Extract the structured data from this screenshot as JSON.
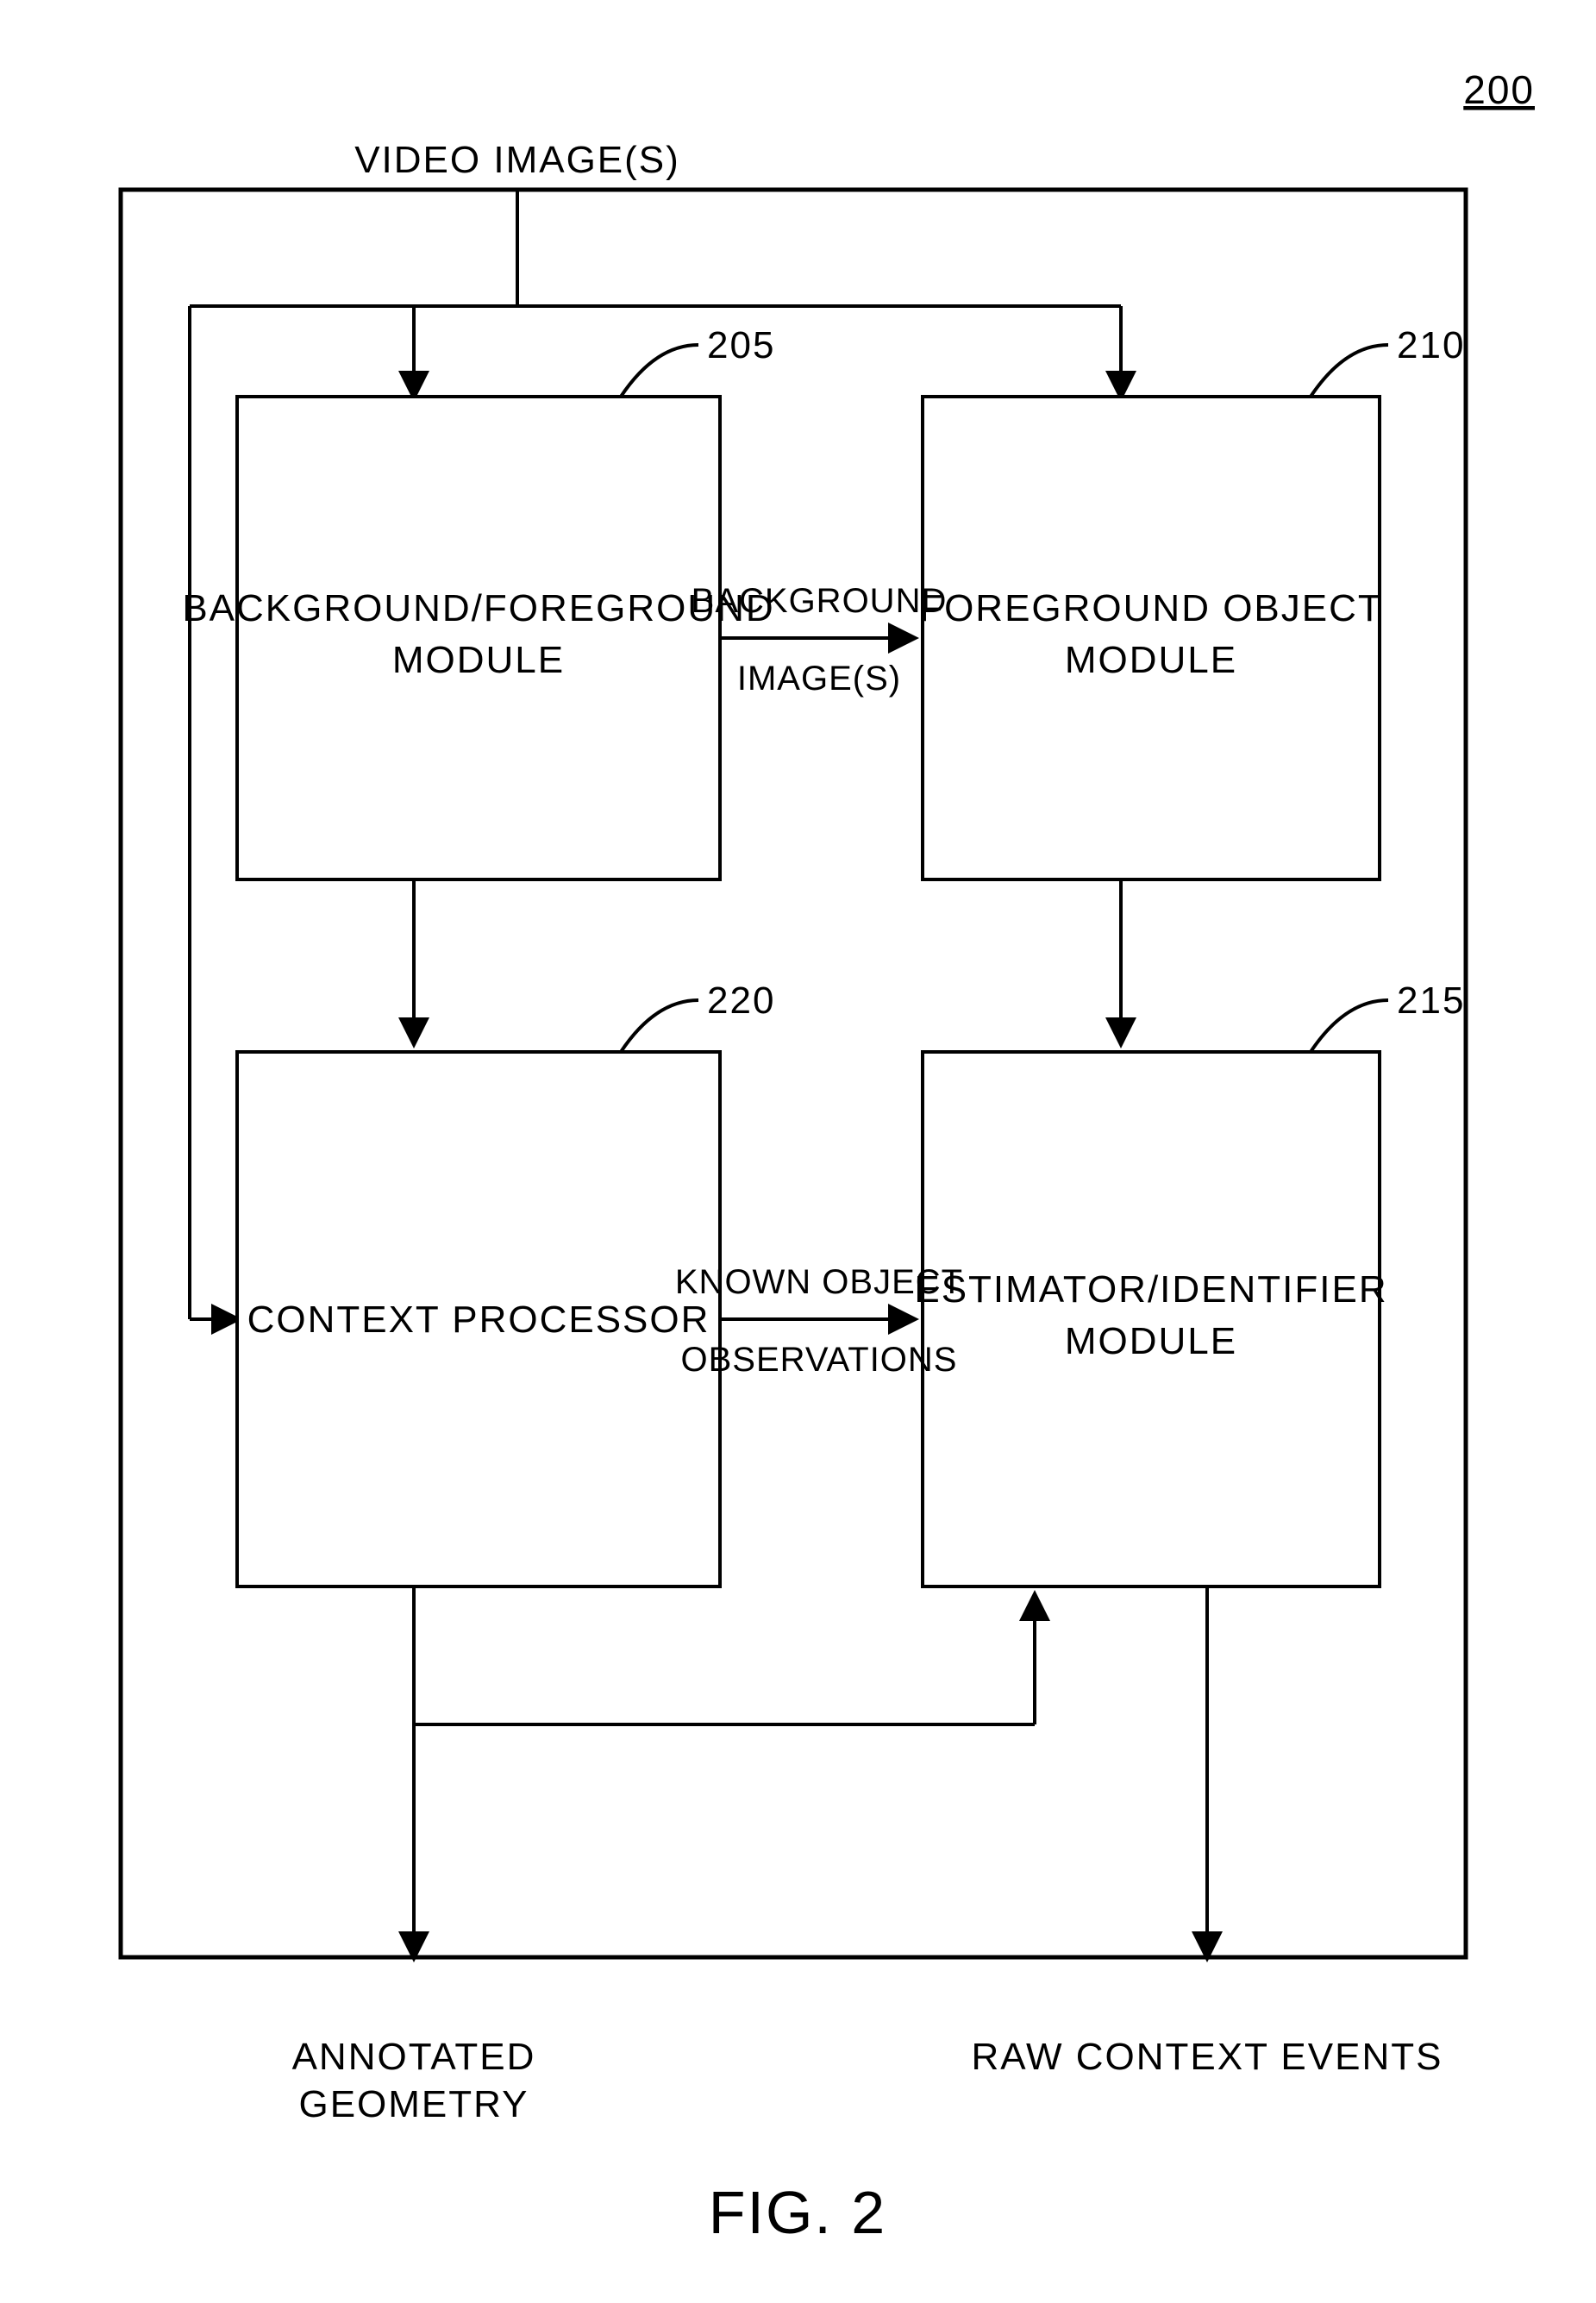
{
  "figure_label": "FIG. 2",
  "page_number": "200",
  "input_label": "VIDEO IMAGE(S)",
  "outputs": {
    "left": {
      "line1": "ANNOTATED",
      "line2": "GEOMETRY"
    },
    "right": "RAW CONTEXT EVENTS"
  },
  "boxes": {
    "b205": {
      "ref": "205",
      "line1": "BACKGROUND/FOREGROUND",
      "line2": "MODULE"
    },
    "b210": {
      "ref": "210",
      "line1": "FOREGROUND OBJECT",
      "line2": "MODULE"
    },
    "b215": {
      "ref": "215",
      "line1": "ESTIMATOR/IDENTIFIER",
      "line2": "MODULE"
    },
    "b220": {
      "ref": "220",
      "text": "CONTEXT PROCESSOR"
    }
  },
  "edge_labels": {
    "bg_images": {
      "line1": "BACKGROUND",
      "line2": "IMAGE(S)"
    },
    "known_obj": {
      "line1": "KNOWN OBJECT",
      "line2": "OBSERVATIONS"
    }
  }
}
